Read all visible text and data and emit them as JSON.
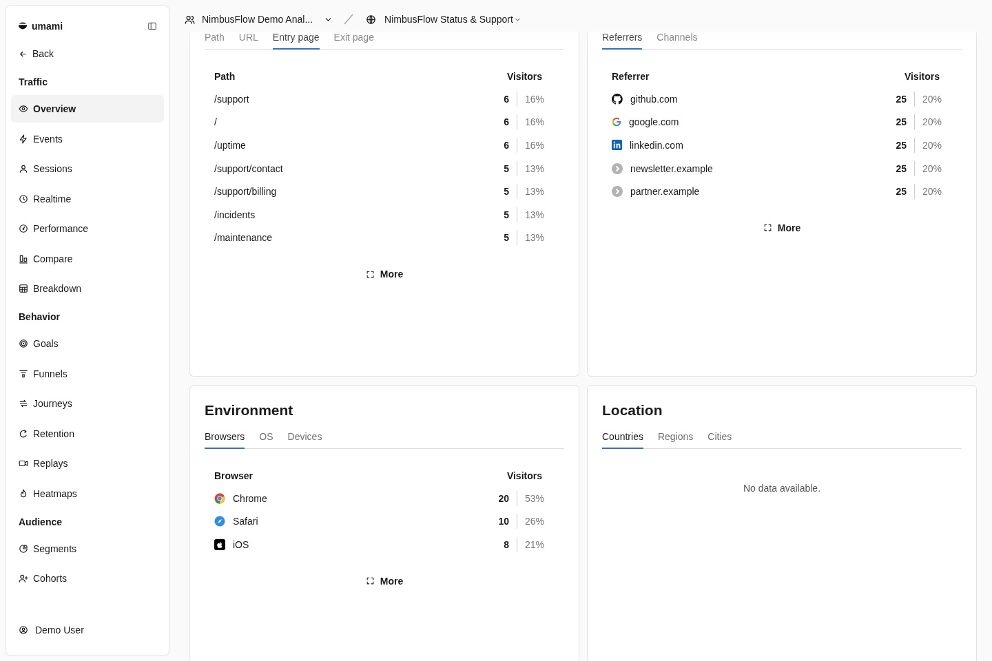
{
  "sidebar": {
    "brand": "umami",
    "back": "Back",
    "sections": [
      {
        "title": "Traffic",
        "items": [
          {
            "label": "Overview",
            "kind": "eye",
            "selected": true
          },
          {
            "label": "Events",
            "kind": "bolt",
            "selected": false
          },
          {
            "label": "Sessions",
            "kind": "person",
            "selected": false
          },
          {
            "label": "Realtime",
            "kind": "clock",
            "selected": false
          },
          {
            "label": "Performance",
            "kind": "gauge",
            "selected": false
          },
          {
            "label": "Compare",
            "kind": "compare",
            "selected": false
          },
          {
            "label": "Breakdown",
            "kind": "table",
            "selected": false
          }
        ]
      },
      {
        "title": "Behavior",
        "items": [
          {
            "label": "Goals",
            "kind": "target",
            "selected": false
          },
          {
            "label": "Funnels",
            "kind": "funnel",
            "selected": false
          },
          {
            "label": "Journeys",
            "kind": "route",
            "selected": false
          },
          {
            "label": "Retention",
            "kind": "retention",
            "selected": false
          },
          {
            "label": "Replays",
            "kind": "video",
            "selected": false
          },
          {
            "label": "Heatmaps",
            "kind": "flame",
            "selected": false
          }
        ]
      },
      {
        "title": "Audience",
        "items": [
          {
            "label": "Segments",
            "kind": "pie",
            "selected": false
          },
          {
            "label": "Cohorts",
            "kind": "userplus",
            "selected": false
          }
        ]
      }
    ],
    "user": "Demo User"
  },
  "header": {
    "team": "NimbusFlow Demo Anal...",
    "website": "NimbusFlow Status & Support"
  },
  "panels": [
    {
      "tabs": [
        {
          "label": "Path",
          "selected": false
        },
        {
          "label": "URL",
          "selected": false
        },
        {
          "label": "Entry page",
          "selected": true
        },
        {
          "label": "Exit page",
          "selected": false
        }
      ],
      "columns": [
        "Path",
        "Visitors"
      ],
      "rows": [
        {
          "label": "/support",
          "value": "6",
          "percent": "16%"
        },
        {
          "label": "/",
          "value": "6",
          "percent": "16%"
        },
        {
          "label": "/uptime",
          "value": "6",
          "percent": "16%"
        },
        {
          "label": "/support/contact",
          "value": "5",
          "percent": "13%"
        },
        {
          "label": "/support/billing",
          "value": "5",
          "percent": "13%"
        },
        {
          "label": "/incidents",
          "value": "5",
          "percent": "13%"
        },
        {
          "label": "/maintenance",
          "value": "5",
          "percent": "13%"
        }
      ],
      "more": "More"
    },
    {
      "tabs": [
        {
          "label": "Referrers",
          "selected": true
        },
        {
          "label": "Channels",
          "selected": false
        }
      ],
      "columns": [
        "Referrer",
        "Visitors"
      ],
      "rows": [
        {
          "label": "github.com",
          "kind": "github",
          "value": "25",
          "percent": "20%"
        },
        {
          "label": "google.com",
          "kind": "google",
          "value": "25",
          "percent": "20%"
        },
        {
          "label": "linkedin.com",
          "kind": "linkedin",
          "value": "25",
          "percent": "20%"
        },
        {
          "label": "newsletter.example",
          "kind": "link",
          "value": "25",
          "percent": "20%"
        },
        {
          "label": "partner.example",
          "kind": "link",
          "value": "25",
          "percent": "20%"
        }
      ],
      "more": "More"
    },
    {
      "title": "Environment",
      "tabs": [
        {
          "label": "Browsers",
          "selected": true
        },
        {
          "label": "OS",
          "selected": false
        },
        {
          "label": "Devices",
          "selected": false
        }
      ],
      "columns": [
        "Browser",
        "Visitors"
      ],
      "rows": [
        {
          "label": "Chrome",
          "kind": "chrome",
          "value": "20",
          "percent": "53%"
        },
        {
          "label": "Safari",
          "kind": "safari",
          "value": "10",
          "percent": "26%"
        },
        {
          "label": "iOS",
          "kind": "apple",
          "value": "8",
          "percent": "21%"
        }
      ],
      "more": "More"
    },
    {
      "title": "Location",
      "tabs": [
        {
          "label": "Countries",
          "selected": true
        },
        {
          "label": "Regions",
          "selected": false
        },
        {
          "label": "Cities",
          "selected": false
        }
      ],
      "empty": "No data available."
    }
  ]
}
